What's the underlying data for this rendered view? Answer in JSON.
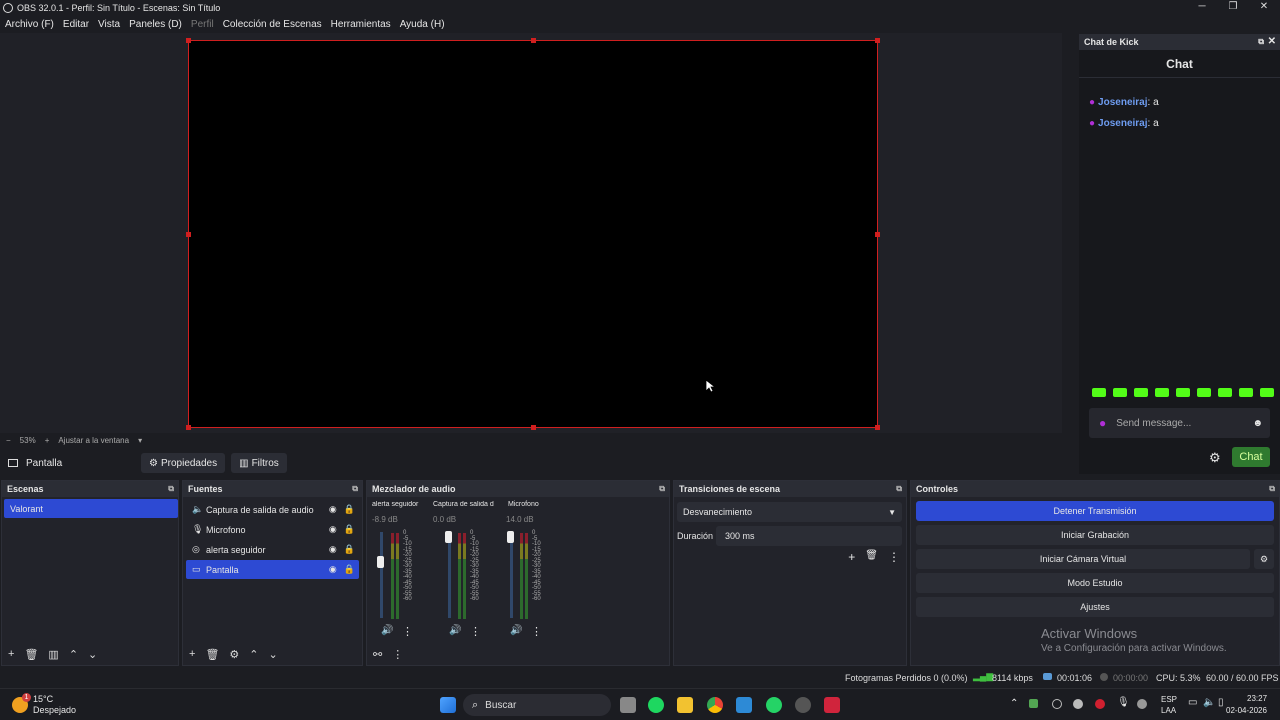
{
  "window": {
    "title": "OBS 32.0.1 - Perfil: Sin Título - Escenas: Sin Título",
    "minimize": "─",
    "maximize": "❐",
    "close": "✕"
  },
  "menu": [
    "Archivo (F)",
    "Editar",
    "Vista",
    "Paneles (D)",
    "Perfil",
    "Colección de Escenas",
    "Herramientas",
    "Ayuda (H)"
  ],
  "zoom": {
    "minus": "−",
    "value": "53%",
    "plus": "+",
    "fit": "Ajustar a la ventana"
  },
  "source_toolbar": {
    "source": "Pantalla",
    "properties": "Propiedades",
    "filters": "Filtros"
  },
  "chat": {
    "dock_title": "Chat de Kick",
    "header": "Chat",
    "messages": [
      {
        "user": "Joseneiraj",
        "text": ": a"
      },
      {
        "user": "Joseneiraj",
        "text": ": a"
      }
    ],
    "input_placeholder": "Send message...",
    "send_button": "Chat"
  },
  "scenes": {
    "title": "Escenas",
    "items": [
      "Valorant"
    ]
  },
  "sources": {
    "title": "Fuentes",
    "items": [
      {
        "label": "Captura de salida de audio",
        "icon": "speaker-icon"
      },
      {
        "label": "Microfono",
        "icon": "microphone-icon"
      },
      {
        "label": "alerta seguidor",
        "icon": "browser-icon"
      },
      {
        "label": "Pantalla",
        "icon": "monitor-icon"
      }
    ]
  },
  "mixer": {
    "title": "Mezclador de audio",
    "channels": [
      {
        "name": "alerta seguidor",
        "db": "-8.9 dB",
        "level": 0.45
      },
      {
        "name": "Captura de salida d",
        "db": "0.0 dB",
        "level": 0.95
      },
      {
        "name": "Microfono",
        "db": "14.0 dB",
        "level": 0.95
      }
    ],
    "scale": [
      "0",
      "-5",
      "-10",
      "-15",
      "-20",
      "-25",
      "-30",
      "-35",
      "-40",
      "-45",
      "-50",
      "-55",
      "-60"
    ]
  },
  "transitions": {
    "title": "Transiciones de escena",
    "selected": "Desvanecimiento",
    "duration_label": "Duración",
    "duration_value": "300 ms"
  },
  "controls": {
    "title": "Controles",
    "buttons": [
      "Detener Transmisión",
      "Iniciar Grabación",
      "Iniciar Cámara Virtual",
      "Modo Estudio",
      "Ajustes"
    ]
  },
  "watermark": {
    "line1": "Activar Windows",
    "line2": "Ve a Configuración para activar Windows."
  },
  "status": {
    "dropped": "Fotogramas Perdidos 0 (0.0%)",
    "bitrate": "8114 kbps",
    "stream_time": "00:01:06",
    "rec_time": "00:00:00",
    "cpu": "CPU: 5.3%",
    "fps": "60.00 / 60.00 FPS"
  },
  "taskbar": {
    "temp": "15°C",
    "weather": "Despejado",
    "search": "Buscar",
    "lang1": "ESP",
    "lang2": "LAA",
    "time": "23:27",
    "date": "02-04-2026",
    "badge": "1"
  },
  "colors": {
    "accent": "#2d4ad3",
    "selection_border": "#d01f1f",
    "kick_green": "#53fc18",
    "chat_user": "#6e9cf0"
  }
}
